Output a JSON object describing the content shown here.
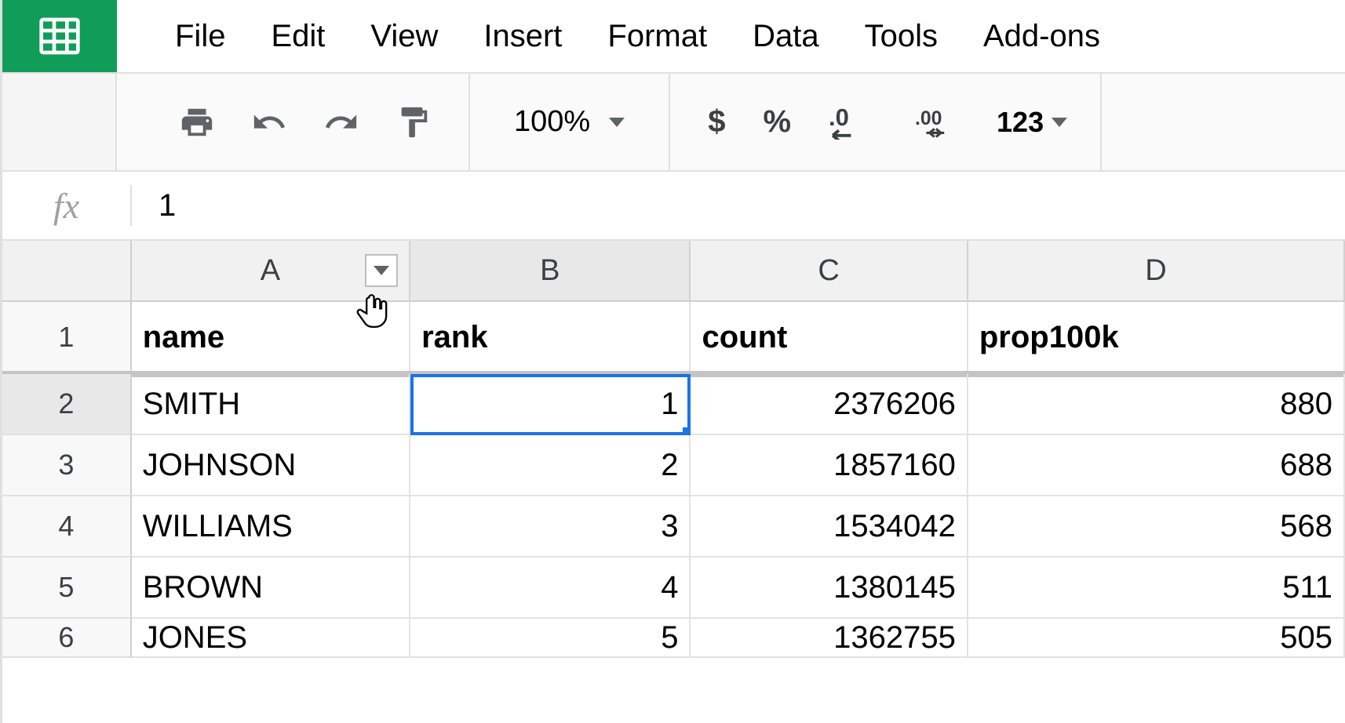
{
  "menubar": [
    "File",
    "Edit",
    "View",
    "Insert",
    "Format",
    "Data",
    "Tools",
    "Add-ons"
  ],
  "toolbar": {
    "zoom": "100%",
    "currency": "$",
    "percent": "%",
    "more_formats": "123"
  },
  "fx": {
    "label": "fx",
    "value": "1"
  },
  "columns": [
    "A",
    "B",
    "C",
    "D"
  ],
  "headers": {
    "A": "name",
    "B": "rank",
    "C": "count",
    "D": "prop100k"
  },
  "rows": [
    {
      "n": "1"
    },
    {
      "n": "2",
      "A": "SMITH",
      "B": "1",
      "C": "2376206",
      "D": "880"
    },
    {
      "n": "3",
      "A": "JOHNSON",
      "B": "2",
      "C": "1857160",
      "D": "688"
    },
    {
      "n": "4",
      "A": "WILLIAMS",
      "B": "3",
      "C": "1534042",
      "D": "568"
    },
    {
      "n": "5",
      "A": "BROWN",
      "B": "4",
      "C": "1380145",
      "D": "511"
    },
    {
      "n": "6",
      "A": "JONES",
      "B": "5",
      "C": "1362755",
      "D": "505"
    }
  ],
  "selected_cell": "B2"
}
